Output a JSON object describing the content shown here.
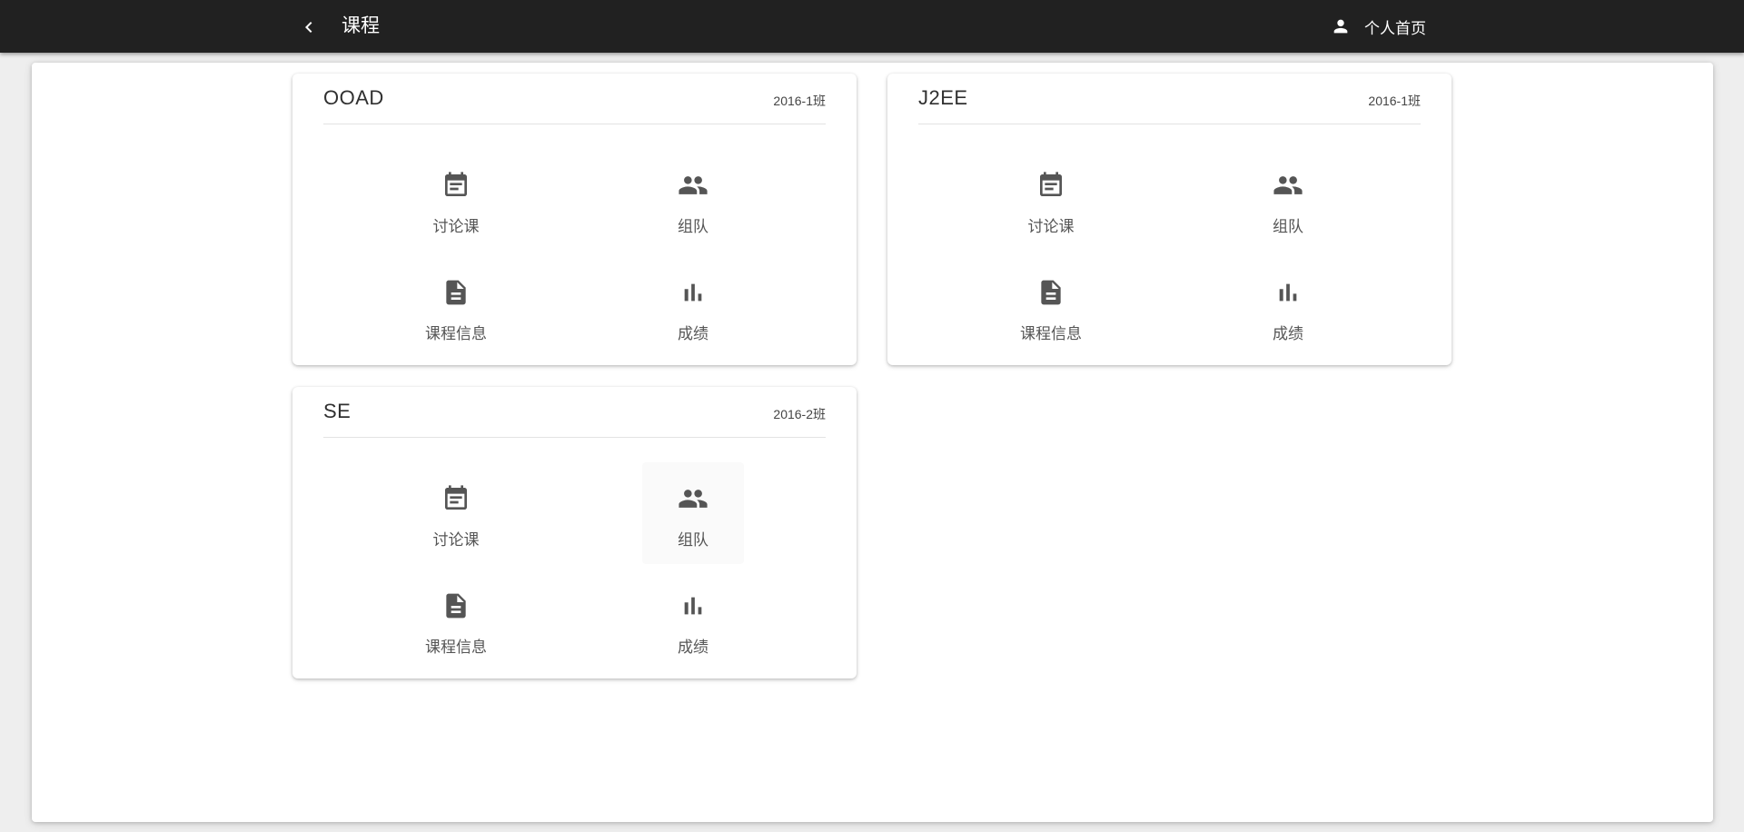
{
  "header": {
    "title": "课程",
    "back_icon": "chevron-left-icon",
    "profile_icon": "person-icon",
    "profile_label": "个人首页"
  },
  "colors": {
    "appbar": "#212121",
    "icon": "#555555",
    "background": "#eeeeee"
  },
  "courses": [
    {
      "name": "OOAD",
      "class": "2016-1班",
      "actions": [
        {
          "label": "讨论课",
          "icon": "calendar-icon"
        },
        {
          "label": "组队",
          "icon": "group-icon"
        },
        {
          "label": "课程信息",
          "icon": "document-icon"
        },
        {
          "label": "成绩",
          "icon": "bar-chart-icon"
        }
      ]
    },
    {
      "name": "J2EE",
      "class": "2016-1班",
      "actions": [
        {
          "label": "讨论课",
          "icon": "calendar-icon"
        },
        {
          "label": "组队",
          "icon": "group-icon"
        },
        {
          "label": "课程信息",
          "icon": "document-icon"
        },
        {
          "label": "成绩",
          "icon": "bar-chart-icon"
        }
      ]
    },
    {
      "name": "SE",
      "class": "2016-2班",
      "actions": [
        {
          "label": "讨论课",
          "icon": "calendar-icon"
        },
        {
          "label": "组队",
          "icon": "group-icon"
        },
        {
          "label": "课程信息",
          "icon": "document-icon"
        },
        {
          "label": "成绩",
          "icon": "bar-chart-icon"
        }
      ]
    }
  ]
}
